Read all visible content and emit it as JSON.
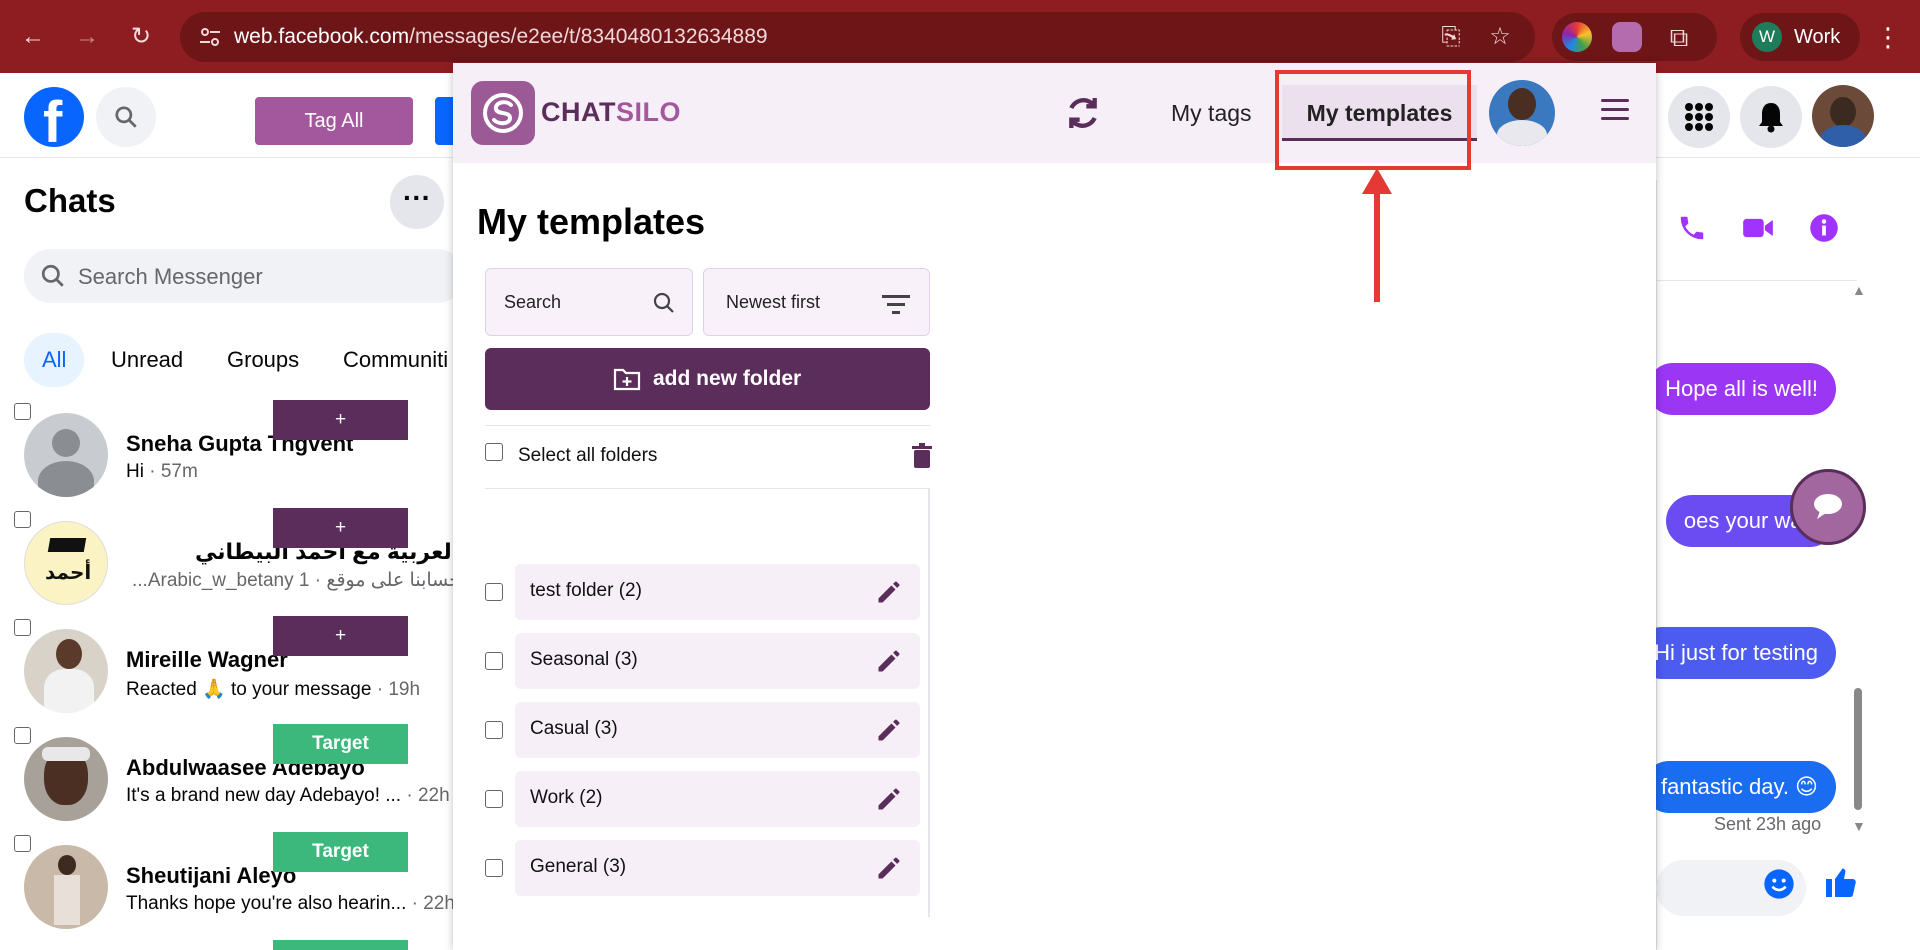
{
  "browser": {
    "url_host": "web.facebook.com",
    "url_path": "/messages/e2ee/t/8340480132634889",
    "profile_initial": "W",
    "profile_label": "Work"
  },
  "fb": {
    "logo_letter": "f",
    "tag_all_label": "Tag All"
  },
  "chats": {
    "title": "Chats",
    "more_label": "···",
    "search_placeholder": "Search Messenger",
    "filters": [
      "All",
      "Unread",
      "Groups",
      "Communiti"
    ],
    "rows": [
      {
        "name": "Sneha Gupta Thgvent",
        "preview": "Hi",
        "time": " · 57m",
        "badge": "+",
        "badge_type": "plus"
      },
      {
        "name": "اللغة العربية مع أحمد البيطاني",
        "preview": "...Arabic_w_betany حسابنا على موقع",
        "time": " · 1",
        "badge": "+",
        "badge_type": "plus"
      },
      {
        "name": "Mireille Wagner",
        "preview": "Reacted 🙏 to your message",
        "time": " · 19h",
        "badge": "+",
        "badge_type": "plus"
      },
      {
        "name": "Abdulwaasee Adebayo",
        "preview": "It's a brand new day Adebayo! ...",
        "time": " · 22h",
        "badge": "Target",
        "badge_type": "target"
      },
      {
        "name": "Sheutijani Aleyo",
        "preview": "Thanks hope you're also hearin...",
        "time": " · 22h",
        "badge": "Target",
        "badge_type": "target"
      }
    ]
  },
  "conversation": {
    "bubbles": [
      {
        "text": "Hope all is well!",
        "color": "#9b36f5"
      },
      {
        "text": "oes your way.",
        "color": "#6b4cf3"
      },
      {
        "text": "Hi just for testing",
        "color": "#4d5cf0"
      },
      {
        "text": "fantastic day. 😊",
        "color": "#1a6cf0"
      }
    ],
    "sent_ago": "Sent 23h ago"
  },
  "chatsilo": {
    "brand_a": "CHAT",
    "brand_b": "SILO",
    "tabs": {
      "tags": "My tags",
      "templates": "My templates"
    },
    "page_title": "My templates",
    "search_placeholder": "Search",
    "sort_value": "Newest first",
    "add_folder_label": "add new folder",
    "select_all_label": "Select all folders",
    "folders": [
      {
        "label": "test folder  (2)"
      },
      {
        "label": "Seasonal  (3)"
      },
      {
        "label": "Casual  (3)"
      },
      {
        "label": "Work  (2)"
      },
      {
        "label": "General  (3)"
      }
    ]
  },
  "colors": {
    "brand_purple": "#5b2d5a",
    "highlight_red": "#e53935",
    "chrome_red": "#8e1d21"
  }
}
